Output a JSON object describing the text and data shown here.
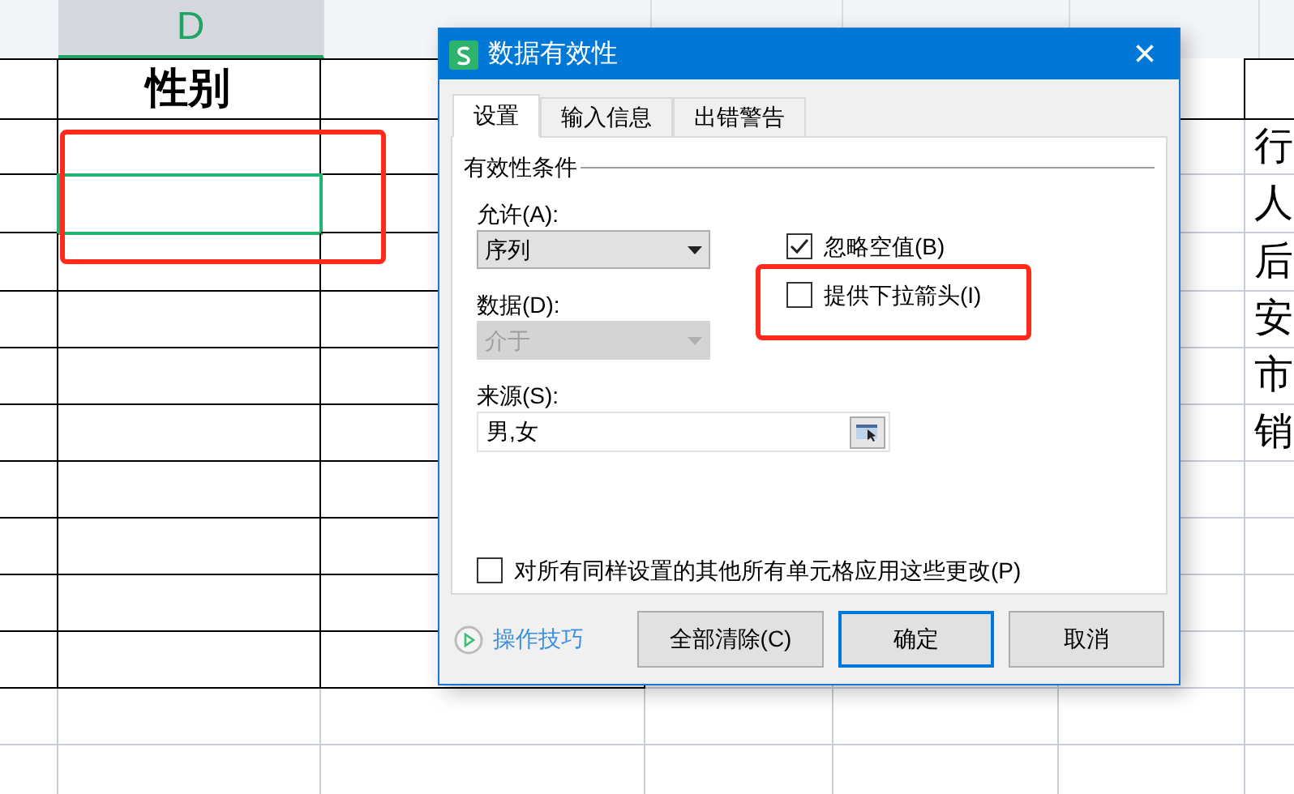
{
  "sheet": {
    "columns": [
      {
        "label": "D",
        "selected": true
      }
    ],
    "header_cells": [
      "性别"
    ],
    "rows": [
      {
        "selected": false,
        "last_cell": "行"
      },
      {
        "selected": true,
        "last_cell": "人"
      },
      {
        "selected": false,
        "last_cell": "后"
      },
      {
        "selected": false,
        "last_cell": "安"
      },
      {
        "selected": false,
        "last_cell": "市"
      },
      {
        "selected": false,
        "last_cell": "销"
      },
      {
        "selected": false
      },
      {
        "selected": false
      },
      {
        "selected": false
      },
      {
        "selected": false
      },
      {
        "selected": false
      },
      {
        "selected": false
      }
    ]
  },
  "dialog": {
    "title": "数据有效性",
    "close": "×",
    "tabs": [
      {
        "label": "设置",
        "selected": true
      },
      {
        "label": "输入信息",
        "selected": false
      },
      {
        "label": "出错警告",
        "selected": false
      }
    ],
    "group_label": "有效性条件",
    "allow": {
      "label": "允许(A):",
      "value": "序列",
      "disabled": false
    },
    "data": {
      "label": "数据(D):",
      "value": "介于",
      "disabled": true
    },
    "source": {
      "label": "来源(S):",
      "value": "男,女"
    },
    "options": [
      {
        "label": "忽略空值(B)",
        "checked": true
      },
      {
        "label": "提供下拉箭头(I)",
        "checked": false
      }
    ],
    "apply_all": {
      "label": "对所有同样设置的其他所有单元格应用这些更改(P)",
      "checked": false
    },
    "tips_link": "操作技巧",
    "buttons": [
      {
        "label": "全部清除(C)",
        "default": false
      },
      {
        "label": "确定",
        "default": true
      },
      {
        "label": "取消",
        "default": false
      }
    ]
  }
}
